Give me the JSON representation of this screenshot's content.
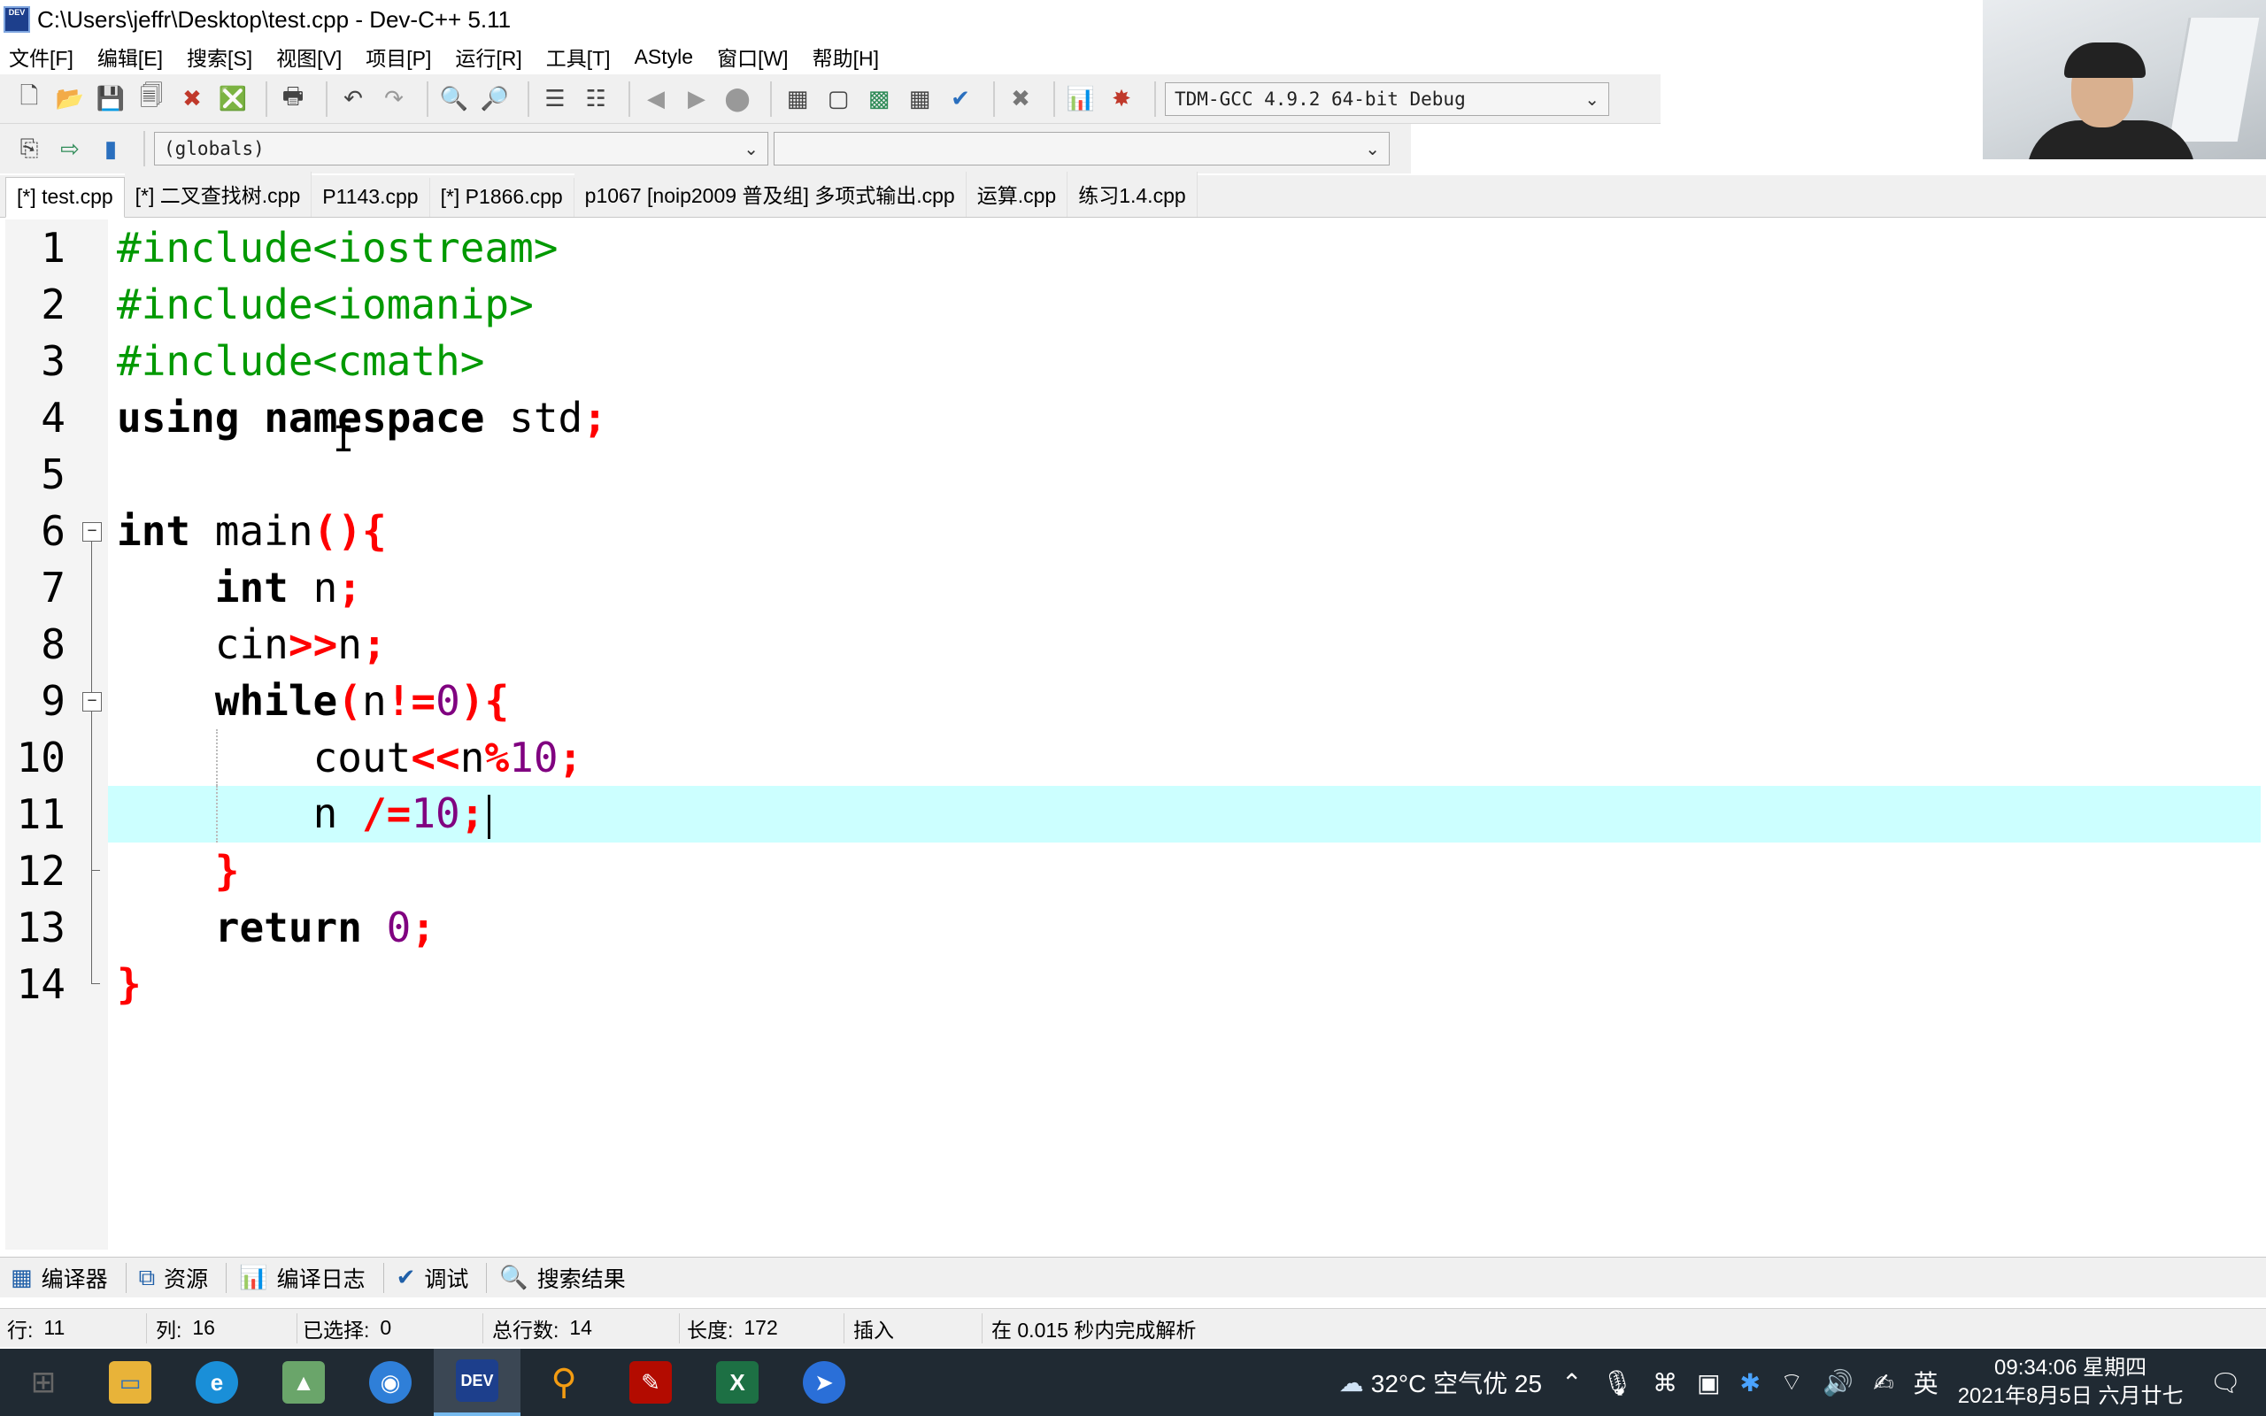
{
  "window": {
    "title": "C:\\Users\\jeffr\\Desktop\\test.cpp - Dev-C++ 5.11",
    "icon_text": "DEV"
  },
  "menu": [
    "文件[F]",
    "编辑[E]",
    "搜索[S]",
    "视图[V]",
    "项目[P]",
    "运行[R]",
    "工具[T]",
    "AStyle",
    "窗口[W]",
    "帮助[H]"
  ],
  "toolbar": {
    "compiler": "TDM-GCC 4.9.2 64-bit Debug",
    "scope": "(globals)",
    "member": ""
  },
  "tabs": [
    "[*] test.cpp",
    "[*] 二叉查找树.cpp",
    "P1143.cpp",
    "[*] P1866.cpp",
    "p1067 [noip2009 普及组] 多项式输出.cpp",
    "运算.cpp",
    "练习1.4.cpp"
  ],
  "editor": {
    "line_numbers": [
      "1",
      "2",
      "3",
      "4",
      "5",
      "6",
      "7",
      "8",
      "9",
      "10",
      "11",
      "12",
      "13",
      "14"
    ],
    "lines": {
      "l1": "#include<iostream>",
      "l2": "#include<iomanip>",
      "l3": "#include<cmath>",
      "l4": {
        "kw1": "using",
        "kw2": "namespace",
        "id": "std",
        "semi": ";"
      },
      "l6": {
        "kw": "int",
        "id": "main",
        "sym": "(){"
      },
      "l7": {
        "kw": "int",
        "id": "n",
        "semi": ";"
      },
      "l8": {
        "id1": "cin",
        "op": ">>",
        "id2": "n",
        "semi": ";"
      },
      "l9": {
        "kw": "while",
        "open": "(",
        "id": "n",
        "op": "!=",
        "num": "0",
        "close": "){"
      },
      "l10": {
        "id1": "cout",
        "op1": "<<",
        "id2": "n",
        "op2": "%",
        "num": "10",
        "semi": ";"
      },
      "l11": {
        "id": "n",
        "op": "/=",
        "num": "10",
        "semi": ";"
      },
      "l12": "}",
      "l13": {
        "kw": "return",
        "num": "0",
        "semi": ";"
      },
      "l14": "}"
    }
  },
  "bottom_tabs": [
    "编译器",
    "资源",
    "编译日志",
    "调试",
    "搜索结果"
  ],
  "status": {
    "row_label": "行:",
    "row": "11",
    "col_label": "列:",
    "col": "16",
    "sel_label": "已选择:",
    "sel": "0",
    "total_label": "总行数:",
    "total": "14",
    "len_label": "长度:",
    "len": "172",
    "mode": "插入",
    "message": "在 0.015 秒内完成解析"
  },
  "taskbar": {
    "weather": "32°C 空气优 25",
    "ime": "英",
    "time": "09:34:06 星期四",
    "date": "2021年8月5日 六月廿七",
    "dev_label": "DEV",
    "excel_label": "X"
  }
}
